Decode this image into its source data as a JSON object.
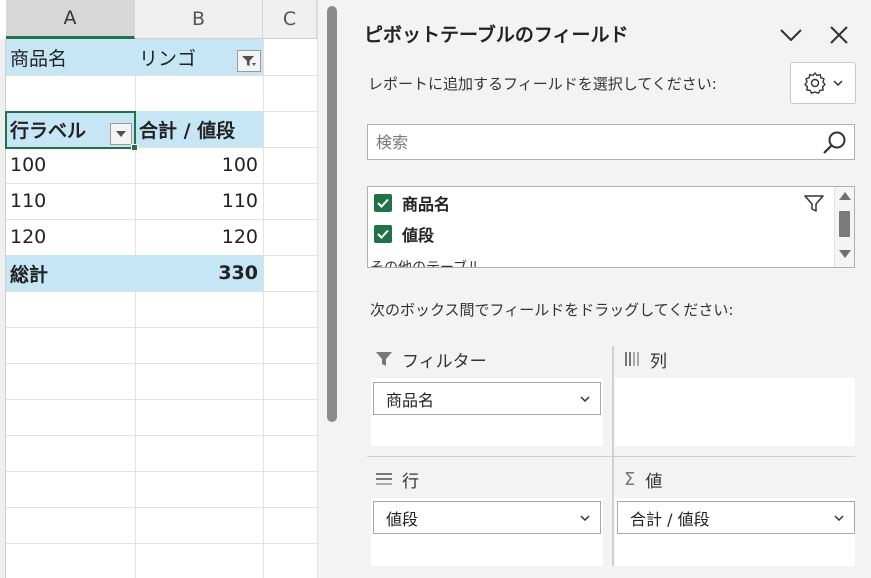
{
  "sheet": {
    "columns": [
      "A",
      "B",
      "C"
    ],
    "filter_label": "商品名",
    "filter_value": "リンゴ",
    "row_label_header": "行ラベル",
    "sum_header": "合計 / 値段",
    "rows": [
      {
        "label": "100",
        "value": "100"
      },
      {
        "label": "110",
        "value": "110"
      },
      {
        "label": "120",
        "value": "120"
      }
    ],
    "grand_total_label": "総計",
    "grand_total_value": "330"
  },
  "pane": {
    "title": "ピボットテーブルのフィールド",
    "instruction_fields": "レポートに追加するフィールドを選択してください:",
    "search_placeholder": "検索",
    "fields": [
      {
        "label": "商品名",
        "checked": true,
        "filtered": true
      },
      {
        "label": "値段",
        "checked": true,
        "filtered": false
      }
    ],
    "other_tables_label": "その他のテーブル...",
    "instruction_areas": "次のボックス間でフィールドをドラッグしてください:",
    "areas": {
      "filter": {
        "label": "フィルター",
        "item": "商品名"
      },
      "columns": {
        "label": "列"
      },
      "rows": {
        "label": "行",
        "item": "値段"
      },
      "values": {
        "label": "値",
        "item": "合計 / 値段"
      }
    }
  },
  "colors": {
    "accent_green": "#217346",
    "pivot_blue": "#c6e6f5"
  },
  "icons": [
    "filter-icon",
    "dropdown-arrow-icon",
    "chevron-down-icon",
    "close-icon",
    "gear-icon",
    "search-icon",
    "checkbox-icon",
    "columns-icon",
    "rows-icon",
    "sigma-icon"
  ]
}
